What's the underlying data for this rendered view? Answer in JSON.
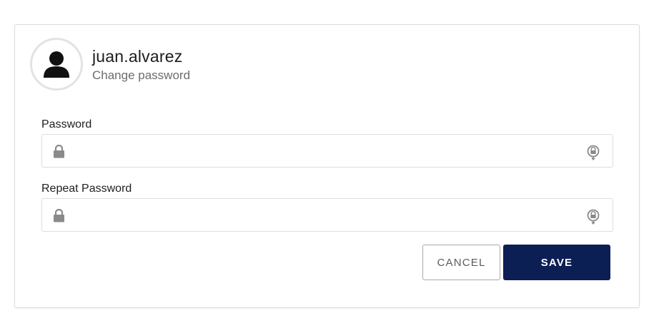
{
  "profile": {
    "username": "juan.alvarez",
    "subtitle": "Change password",
    "avatar_icon": "user-silhouette-icon"
  },
  "form": {
    "password_label": "Password",
    "password_value": "",
    "repeat_password_label": "Repeat Password",
    "repeat_password_value": "",
    "field_leading_icon": "lock-icon",
    "field_trailing_icon": "reveal-password-icon"
  },
  "actions": {
    "cancel_label": "CANCEL",
    "save_label": "SAVE"
  },
  "colors": {
    "primary": "#0b1f54",
    "icon_gray": "#8a8a8a",
    "border": "#dedede"
  }
}
